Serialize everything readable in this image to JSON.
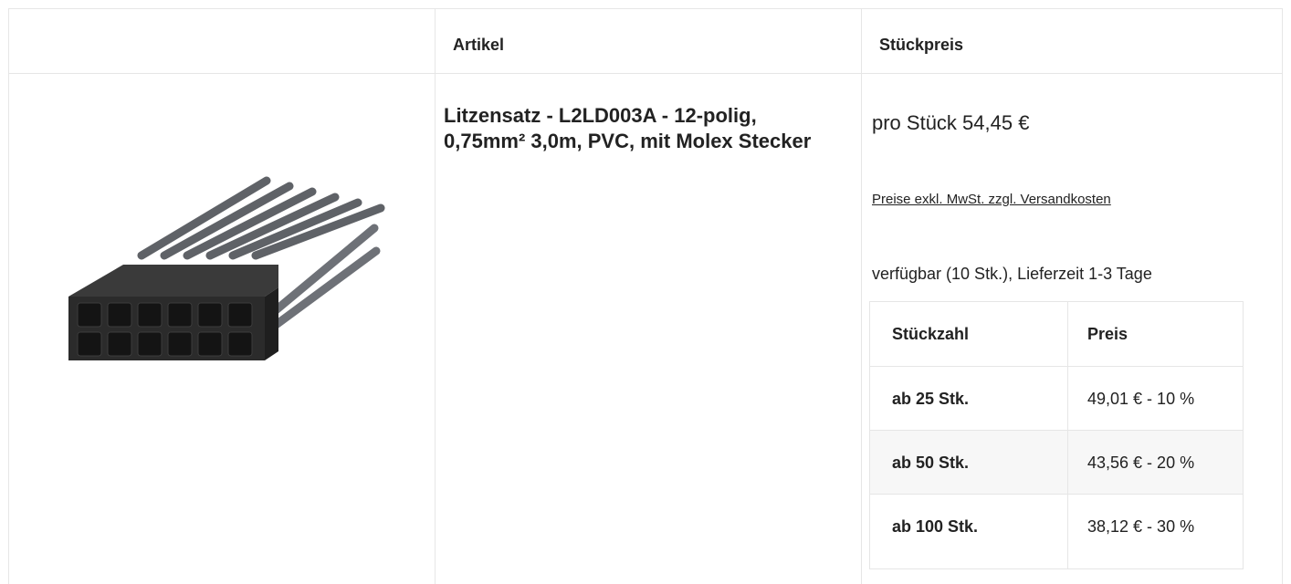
{
  "headers": {
    "image": "",
    "article": "Artikel",
    "unit_price": "Stückpreis"
  },
  "product": {
    "title": "Litzensatz - L2LD003A - 12-polig, 0,75mm² 3,0m, PVC, mit Molex Stecker",
    "image_icon": "connector-image",
    "price_label": "pro Stück 54,45 €",
    "vat_note": "Preise exkl. MwSt. zzgl. Versandkosten",
    "availability": "verfügbar (10 Stk.), Lieferzeit 1-3 Tage"
  },
  "tier_table": {
    "headers": [
      "Stückzahl",
      "Preis"
    ],
    "rows": [
      {
        "qty": "ab 25 Stk.",
        "price": "49,01 € - 10 %"
      },
      {
        "qty": "ab 50 Stk.",
        "price": "43,56 € - 20 %"
      },
      {
        "qty": "ab 100 Stk.",
        "price": "38,12 € - 30 %"
      }
    ]
  },
  "colors": {
    "border": "#e6e6e6",
    "text": "#222222",
    "shaded_row": "#f7f7f7",
    "connector": "#2b2b2b",
    "wire": "#6e7177"
  }
}
